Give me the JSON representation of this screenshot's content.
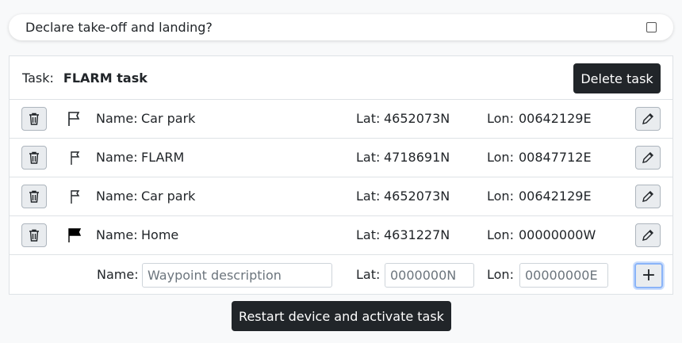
{
  "declare": {
    "label": "Declare take-off and landing?",
    "checked": false
  },
  "task": {
    "label": "Task:",
    "name": "FLARM task",
    "delete_label": "Delete task"
  },
  "labels": {
    "name": "Name:",
    "lat": "Lat:",
    "lon": "Lon:"
  },
  "waypoints": [
    {
      "flag": "flag-outline-icon",
      "name": "Car park",
      "lat": "4652073N",
      "lon": "00642129E"
    },
    {
      "flag": "flag-small-icon",
      "name": "FLARM",
      "lat": "4718691N",
      "lon": "00847712E"
    },
    {
      "flag": "flag-small-icon",
      "name": "Car park",
      "lat": "4652073N",
      "lon": "00642129E"
    },
    {
      "flag": "flag-filled-icon",
      "name": "Home",
      "lat": "4631227N",
      "lon": "00000000W"
    }
  ],
  "new_waypoint": {
    "name_placeholder": "Waypoint description",
    "lat_placeholder": "0000000N",
    "lon_placeholder": "00000000E",
    "add_label": "+"
  },
  "restart_label": "Restart device and activate task"
}
